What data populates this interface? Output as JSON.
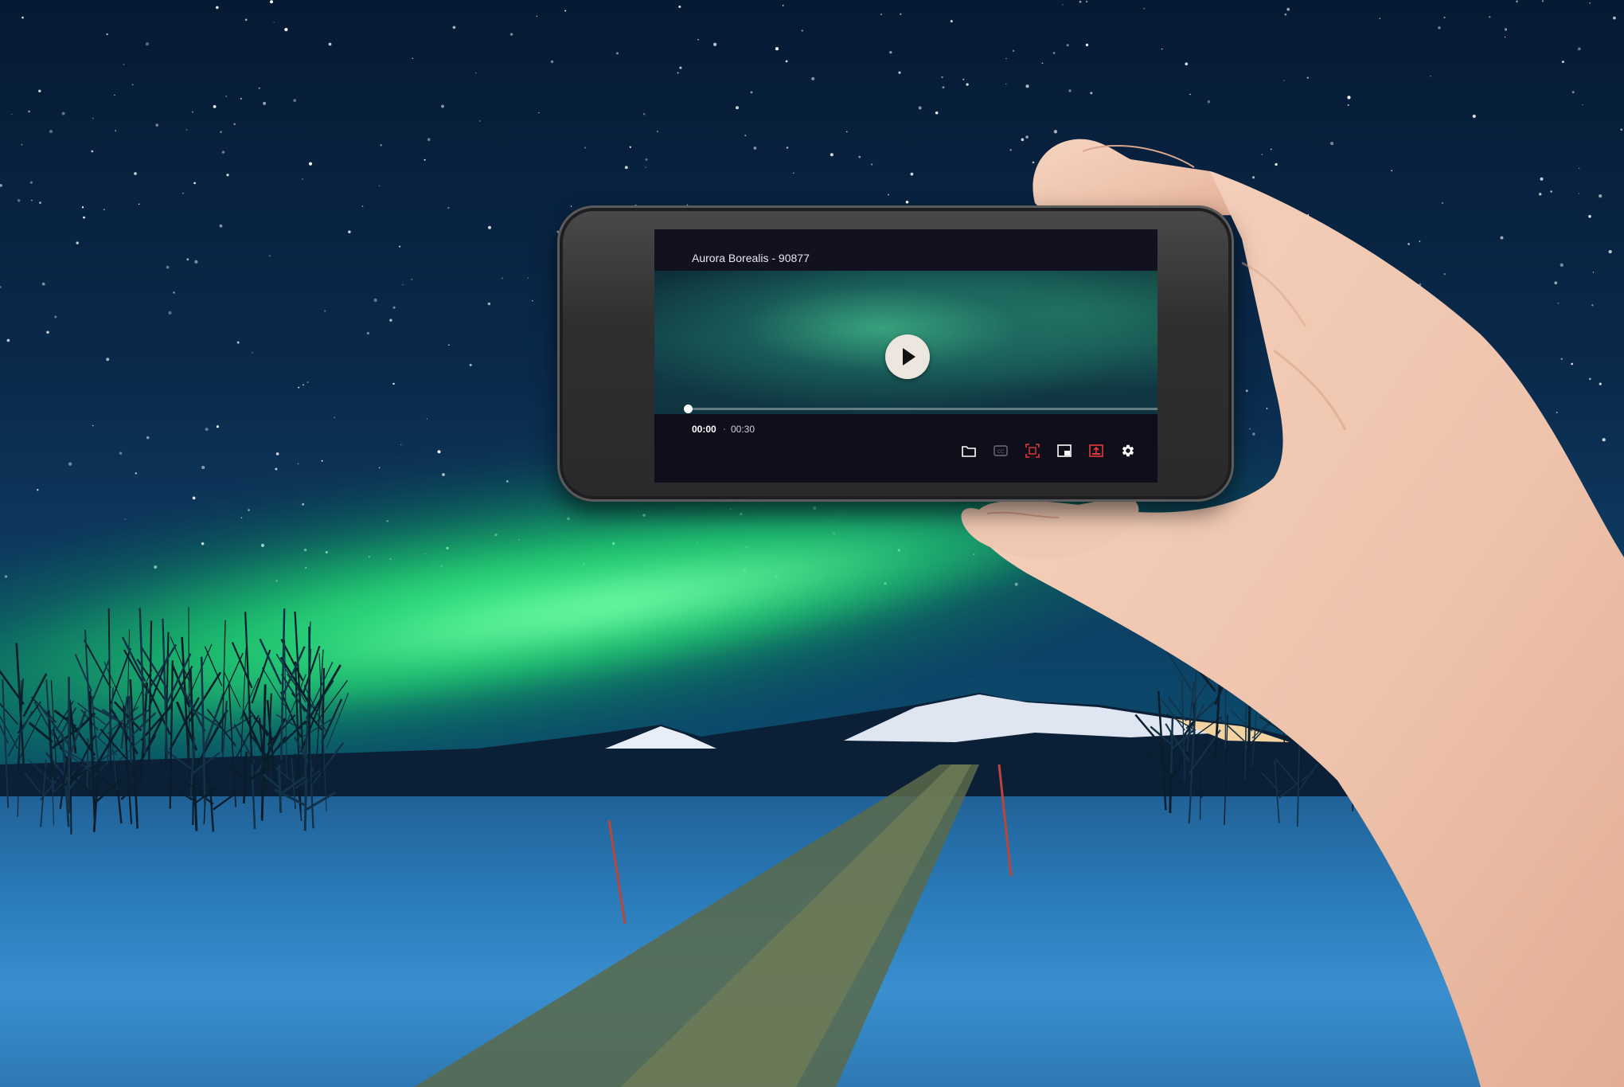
{
  "player": {
    "title": "Aurora Borealis - 90877",
    "time_current": "00:00",
    "time_separator": "·",
    "time_total": "00:30",
    "progress": 0.0
  },
  "toolbar": {
    "items": [
      {
        "name": "folder-icon",
        "color": "#ffffff"
      },
      {
        "name": "captions-icon",
        "color": "#6e6e78"
      },
      {
        "name": "fullscreen-capture-icon",
        "color": "#e53935"
      },
      {
        "name": "picture-in-picture-icon",
        "color": "#ffffff"
      },
      {
        "name": "cast-icon",
        "color": "#e53935"
      },
      {
        "name": "gear-icon",
        "color": "#ffffff"
      }
    ]
  },
  "colors": {
    "accent": "#e53935",
    "screen_bg": "#0f0f1c",
    "play_button": "#ece6df"
  }
}
